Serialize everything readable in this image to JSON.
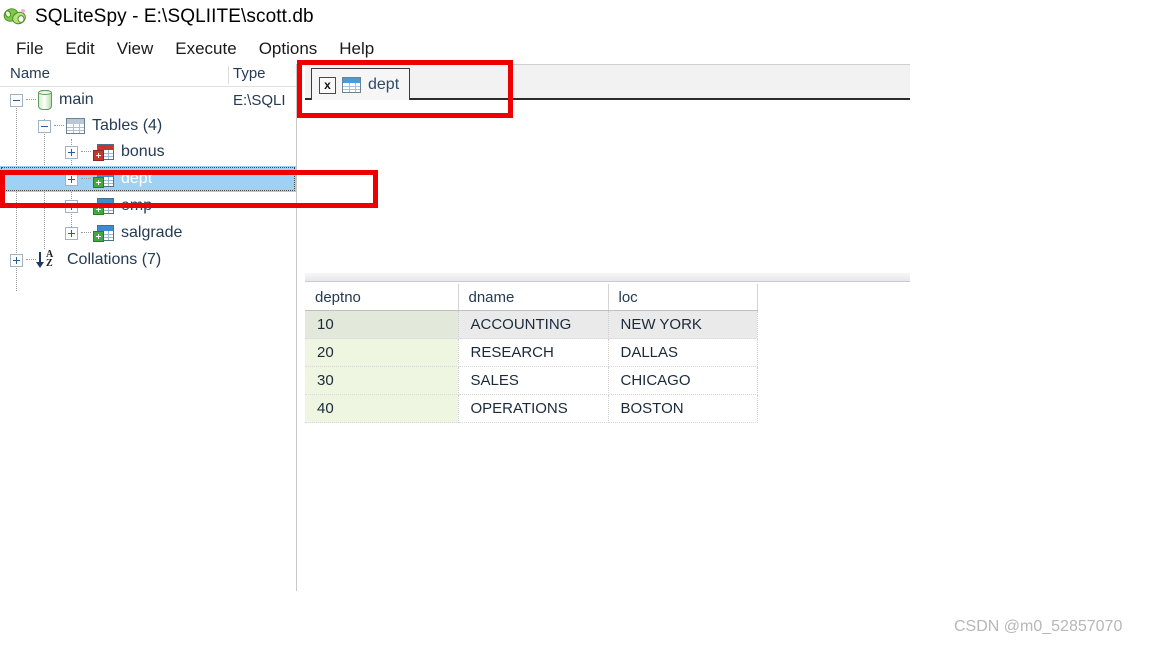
{
  "window": {
    "title": "SQLiteSpy - E:\\SQLIITE\\scott.db",
    "icon": "sqlitespy-logo-icon"
  },
  "menubar": {
    "items": [
      {
        "label": "File"
      },
      {
        "label": "Edit"
      },
      {
        "label": "View"
      },
      {
        "label": "Execute"
      },
      {
        "label": "Options"
      },
      {
        "label": "Help"
      }
    ]
  },
  "tree": {
    "headers": {
      "name": "Name",
      "type": "Type"
    },
    "nodes": [
      {
        "label": "main",
        "type": "E:\\SQLI",
        "icon": "database-cylinder-icon",
        "expander": "minus",
        "selected": false
      },
      {
        "label": "Tables (4)",
        "type": "",
        "icon": "tables-folder-grid-icon",
        "expander": "minus",
        "selected": false
      },
      {
        "label": "bonus",
        "type": "",
        "icon": "table-red-icon",
        "expander": "plus",
        "selected": false
      },
      {
        "label": "dept",
        "type": "",
        "icon": "table-green-icon",
        "expander": "plus",
        "selected": true
      },
      {
        "label": "emp",
        "type": "",
        "icon": "table-green-icon",
        "expander": "plus",
        "selected": false
      },
      {
        "label": "salgrade",
        "type": "",
        "icon": "table-green-icon",
        "expander": "plus",
        "selected": false
      },
      {
        "label": "Collations (7)",
        "type": "",
        "icon": "sort-az-icon",
        "expander": "plus",
        "selected": false
      }
    ]
  },
  "tabs": {
    "items": [
      {
        "label": "dept",
        "close_label": "x",
        "icon": "table-grid-icon",
        "active": true
      }
    ]
  },
  "editor": {
    "content": ""
  },
  "results": {
    "columns": [
      "deptno",
      "dname",
      "loc"
    ],
    "rows": [
      {
        "deptno": "10",
        "dname": "ACCOUNTING",
        "loc": "NEW YORK",
        "highlighted": true
      },
      {
        "deptno": "20",
        "dname": "RESEARCH",
        "loc": "DALLAS",
        "highlighted": false
      },
      {
        "deptno": "30",
        "dname": "SALES",
        "loc": "CHICAGO",
        "highlighted": false
      },
      {
        "deptno": "40",
        "dname": "OPERATIONS",
        "loc": "BOSTON",
        "highlighted": false
      }
    ]
  },
  "annotations": {
    "colour": "#ee0000",
    "boxes": [
      {
        "name": "tab-highlight"
      },
      {
        "name": "tree-dept-highlight"
      }
    ]
  },
  "watermark": {
    "text": "CSDN @m0_52857070"
  }
}
